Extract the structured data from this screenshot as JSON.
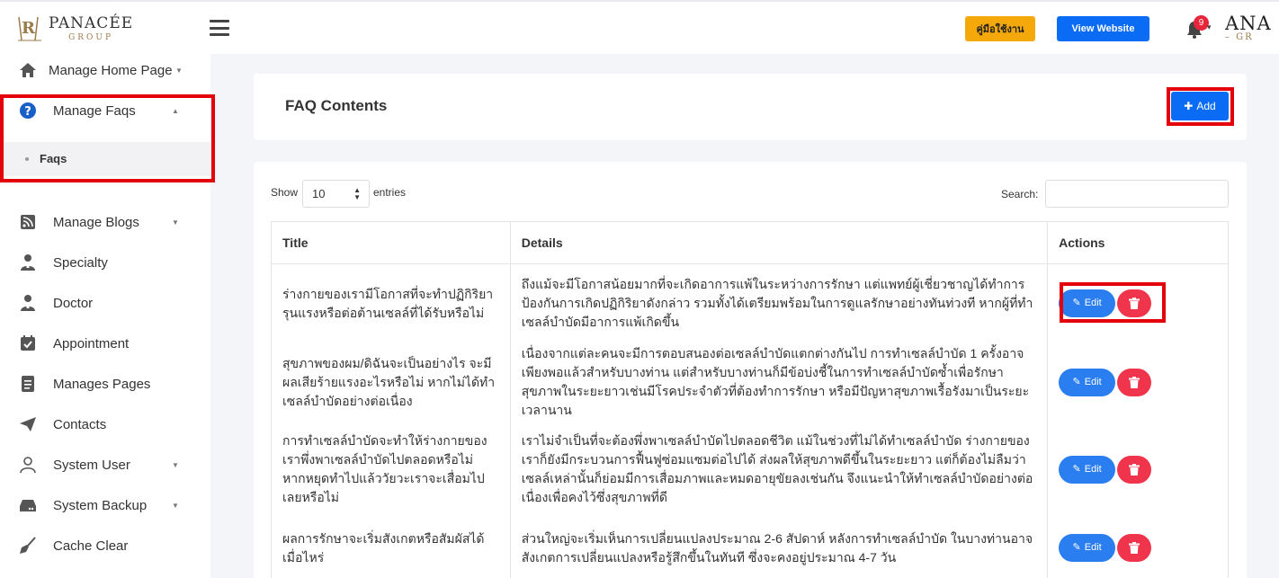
{
  "header": {
    "logo_name": "PANACÉE",
    "logo_group": "GROUP",
    "manual_button": "คู่มือใช้งาน",
    "view_website_button": "View Website",
    "notification_count": "9",
    "user_logo_text": "ANA",
    "user_logo_sub": "– GR"
  },
  "sidebar": {
    "items": [
      {
        "label": "Manage Home Page",
        "icon": "home-icon"
      },
      {
        "label": "Manage Faqs",
        "icon": "question-circle-icon"
      },
      {
        "label": "Manage Blogs",
        "icon": "rss-icon"
      },
      {
        "label": "Specialty",
        "icon": "user-md-icon"
      },
      {
        "label": "Doctor",
        "icon": "user-md-icon"
      },
      {
        "label": "Appointment",
        "icon": "calendar-check-icon"
      },
      {
        "label": "Manages Pages",
        "icon": "file-icon"
      },
      {
        "label": "Contacts",
        "icon": "paper-plane-icon"
      },
      {
        "label": "System User",
        "icon": "user-icon"
      },
      {
        "label": "System Backup",
        "icon": "hdd-icon"
      },
      {
        "label": "Cache Clear",
        "icon": "broom-icon"
      }
    ],
    "sub_item": "Faqs"
  },
  "main": {
    "title": "FAQ Contents",
    "add_button": "Add",
    "show_label": "Show",
    "entries_value": "10",
    "entries_label": "entries",
    "search_label": "Search:",
    "columns": [
      "Title",
      "Details",
      "Actions"
    ],
    "edit_label": "Edit",
    "rows": [
      {
        "title": "ร่างกายของเรามีโอกาสที่จะทำปฏิกิริยารุนแรงหรือต่อต้านเซลล์ที่ได้รับหรือไม่",
        "details": "ถึงแม้จะมีโอกาสน้อยมากที่จะเกิดอาการแพ้ในระหว่างการรักษา แต่แพทย์ผู้เชี่ยวชาญได้ทำการป้องกันการเกิดปฏิกิริยาดังกล่าว รวมทั้งได้เตรียมพร้อมในการดูแลรักษาอย่างทันท่วงที หากผู้ที่ทำเซลล์บำบัดมีอาการแพ้เกิดขึ้น"
      },
      {
        "title": "สุขภาพของผม/ดิฉันจะเป็นอย่างไร จะมีผลเสียร้ายแรงอะไรหรือไม่ หากไม่ได้ทำเซลล์บำบัดอย่างต่อเนื่อง",
        "details": "เนื่องจากแต่ละคนจะมีการตอบสนองต่อเซลล์บำบัดแตกต่างกันไป การทำเซลล์บำบัด 1 ครั้งอาจเพียงพอแล้วสำหรับบางท่าน แต่สำหรับบางท่านก็มีข้อบ่งชี้ในการทำเซลล์บำบัดซ้ำเพื่อรักษาสุขภาพในระยะยาวเช่นมีโรคประจำตัวที่ต้องทำการรักษา หรือมีปัญหาสุขภาพเรื้อรังมาเป็นระยะเวลานาน"
      },
      {
        "title": "การทำเซลล์บำบัดจะทำให้ร่างกายของเราพึ่งพาเซลล์บำบัดไปตลอดหรือไม่ หากหยุดทำไปแล้ววัยวะเราจะเสื่อมไปเลยหรือไม่",
        "details": "เราไม่จำเป็นที่จะต้องพึ่งพาเซลล์บำบัดไปตลอดชีวิต แม้ในช่วงที่ไม่ได้ทำเซลล์บำบัด ร่างกายของเราก็ยังมีกระบวนการฟื้นฟูซ่อมแซมต่อไปได้ ส่งผลให้สุขภาพดีขึ้นในระยะยาว แต่ก็ต้องไม่ลืมว่าเซลล์เหล่านั้นก็ย่อมมีการเสื่อมภาพและหมดอายุขัยลงเช่นกัน จึงแนะนำให้ทำเซลล์บำบัดอย่างต่อเนื่องเพื่อคงไว้ซึ่งสุขภาพที่ดี"
      },
      {
        "title": "ผลการรักษาจะเริ่มสังเกตหรือสัมผัสได้เมื่อไหร่",
        "details": "ส่วนใหญ่จะเริ่มเห็นการเปลี่ยนแปลงประมาณ 2-6 สัปดาห์ หลังการทำเซลล์บำบัด ในบางท่านอาจสังเกตการเปลี่ยนแปลงหรือรู้สึกขึ้นในทันที ซึ่งจะคงอยู่ประมาณ 4-7 วัน"
      }
    ]
  },
  "colors": {
    "primary": "#0a6cf5",
    "manual": "#f4a80a",
    "danger": "#f0344b",
    "highlight": "#e3000b"
  }
}
